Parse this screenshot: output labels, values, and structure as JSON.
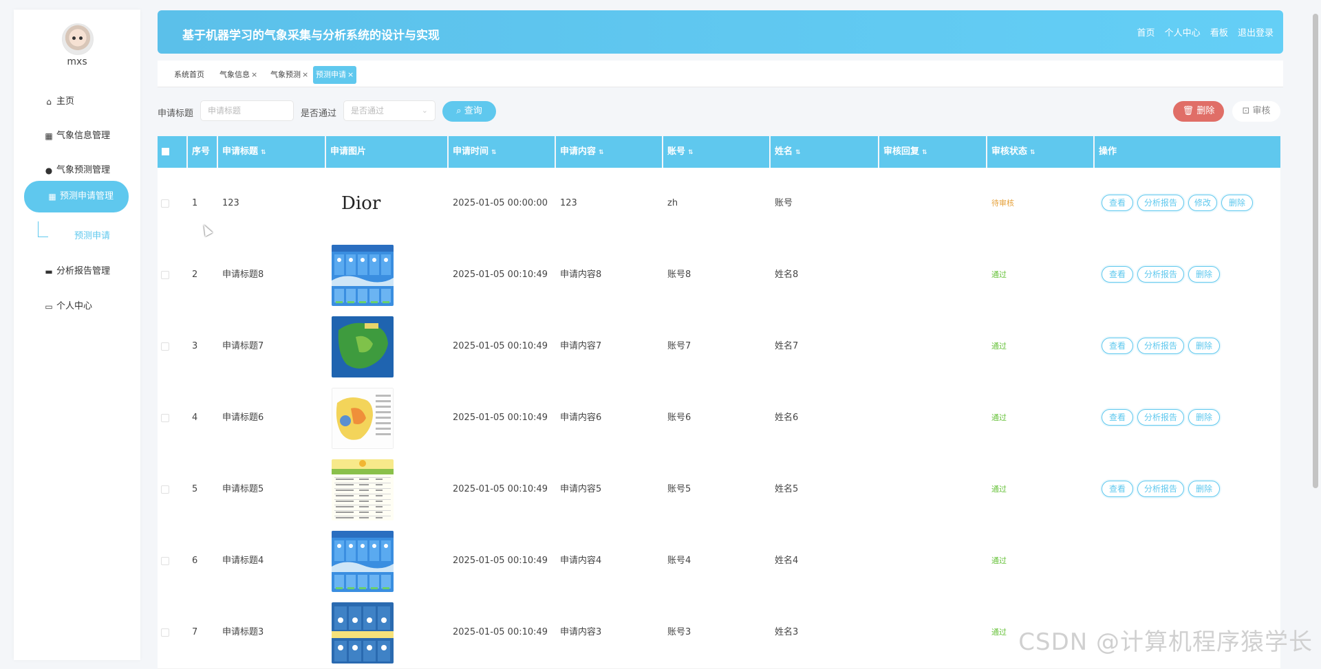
{
  "sidebar": {
    "username": "mxs",
    "items": [
      {
        "label": "主页",
        "icon": "home-icon"
      },
      {
        "label": "气象信息管理",
        "icon": "grid-icon"
      },
      {
        "label": "气象预测管理",
        "icon": "user-icon"
      },
      {
        "label": "预测申请管理",
        "icon": "grid-icon"
      },
      {
        "label": "分析报告管理",
        "icon": "printer-icon"
      },
      {
        "label": "个人中心",
        "icon": "card-icon"
      }
    ],
    "submenu": {
      "label": "预测申请"
    }
  },
  "header": {
    "title": "基于机器学习的气象采集与分析系统的设计与实现",
    "links": [
      "首页",
      "个人中心",
      "看板",
      "退出登录"
    ]
  },
  "tabs": [
    {
      "label": "系统首页",
      "closable": false
    },
    {
      "label": "气象信息",
      "closable": true
    },
    {
      "label": "气象预测",
      "closable": true
    },
    {
      "label": "预测申请",
      "closable": true,
      "active": true
    }
  ],
  "filters": {
    "title_label": "申请标题",
    "title_placeholder": "申请标题",
    "pass_label": "是否通过",
    "pass_placeholder": "是否通过",
    "query_label": "查询",
    "delete_label": "删除",
    "audit_label": "审核"
  },
  "table": {
    "headers": [
      "序号",
      "申请标题",
      "申请图片",
      "申请时间",
      "申请内容",
      "账号",
      "姓名",
      "审核回复",
      "审核状态",
      "操作"
    ],
    "actions": {
      "view": "查看",
      "report": "分析报告",
      "edit": "修改",
      "delete": "删除"
    },
    "rows": [
      {
        "index": "1",
        "title": "123",
        "image": "Dior",
        "time": "2025-01-05 00:00:00",
        "content": "123",
        "account": "zh",
        "name": "账号",
        "reply": "",
        "status": "待审核",
        "status_type": "pending",
        "actions": [
          "view",
          "report",
          "edit",
          "delete"
        ]
      },
      {
        "index": "2",
        "title": "申请标题8",
        "image": "weather-blue",
        "time": "2025-01-05 00:10:49",
        "content": "申请内容8",
        "account": "账号8",
        "name": "姓名8",
        "reply": "",
        "status": "通过",
        "status_type": "pass",
        "actions": [
          "view",
          "report",
          "delete"
        ]
      },
      {
        "index": "3",
        "title": "申请标题7",
        "image": "map-green",
        "time": "2025-01-05 00:10:49",
        "content": "申请内容7",
        "account": "账号7",
        "name": "姓名7",
        "reply": "",
        "status": "通过",
        "status_type": "pass",
        "actions": [
          "view",
          "report",
          "delete"
        ]
      },
      {
        "index": "4",
        "title": "申请标题6",
        "image": "map-yellow",
        "time": "2025-01-05 00:10:49",
        "content": "申请内容6",
        "account": "账号6",
        "name": "姓名6",
        "reply": "",
        "status": "通过",
        "status_type": "pass",
        "actions": [
          "view",
          "report",
          "delete"
        ]
      },
      {
        "index": "5",
        "title": "申请标题5",
        "image": "table-sun",
        "time": "2025-01-05 00:10:49",
        "content": "申请内容5",
        "account": "账号5",
        "name": "姓名5",
        "reply": "",
        "status": "通过",
        "status_type": "pass",
        "actions": [
          "view",
          "report",
          "delete"
        ]
      },
      {
        "index": "6",
        "title": "申请标题4",
        "image": "weather-blue",
        "time": "2025-01-05 00:10:49",
        "content": "申请内容4",
        "account": "账号4",
        "name": "姓名4",
        "reply": "",
        "status": "通过",
        "status_type": "pass",
        "actions": []
      },
      {
        "index": "7",
        "title": "申请标题3",
        "image": "weather-dark",
        "time": "2025-01-05 00:10:49",
        "content": "申请内容3",
        "account": "账号3",
        "name": "姓名3",
        "reply": "",
        "status": "通过",
        "status_type": "pass",
        "actions": []
      }
    ]
  },
  "watermark": "CSDN @计算机程序猿学长",
  "colors": {
    "accent": "#5fc8ee",
    "danger": "#e06e67",
    "pending": "#e6a23c",
    "pass": "#67c23a"
  }
}
